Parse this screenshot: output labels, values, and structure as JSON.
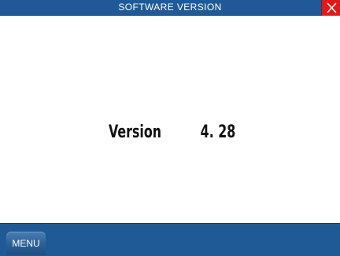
{
  "title_bar": {
    "title": "SOFTWARE  VERSION",
    "close_icon": "close-icon",
    "accent_color": "#1f5a97",
    "close_color": "#e01a1a"
  },
  "content": {
    "version_label": "Version",
    "version_value": "4. 28"
  },
  "bottom_bar": {
    "menu_label": "MENU"
  }
}
